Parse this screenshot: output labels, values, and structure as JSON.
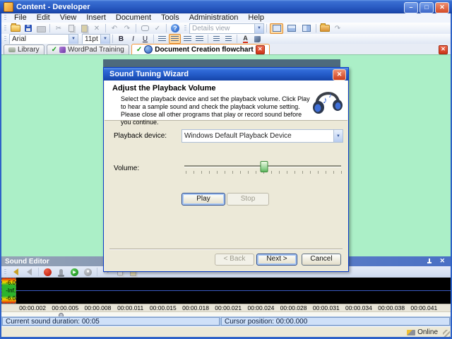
{
  "window": {
    "title": "Content - Developer",
    "status_online": "Online"
  },
  "menu": {
    "items": [
      "File",
      "Edit",
      "View",
      "Insert",
      "Document",
      "Tools",
      "Administration",
      "Help"
    ]
  },
  "toolbars": {
    "details_view": "Details view",
    "font_name": "Arial",
    "font_size": "11pt",
    "bold": "B",
    "italic": "I",
    "underline": "U"
  },
  "tabs": {
    "library": "Library",
    "wordpad": "WordPad Training",
    "flowchart": "Document Creation flowchart"
  },
  "dialog": {
    "title": "Sound Tuning Wizard",
    "heading": "Adjust the Playback Volume",
    "description": "Select the playback device and set the playback volume. Click Play to hear a sample sound and check the playback volume setting. Please close all other programs that play or record sound before you continue.",
    "playback_device_label": "Playback device:",
    "playback_device_value": "Windows Default Playback Device",
    "volume_label": "Volume:",
    "volume_percent": 51,
    "play_label": "Play",
    "stop_label": "Stop",
    "back_label": "< Back",
    "next_label": "Next >",
    "cancel_label": "Cancel"
  },
  "sound_editor": {
    "title": "Sound Editor",
    "meter": {
      "top": "-6.0",
      "mid": "-Inf.",
      "bottom": "-6.0"
    },
    "timeline": [
      "00:00.002",
      "00:00.005",
      "00:00.008",
      "00:00.011",
      "00:00.015",
      "00:00.018",
      "00:00.021",
      "00:00.024",
      "00:00.028",
      "00:00.031",
      "00:00.034",
      "00:00.038",
      "00:00.041"
    ],
    "duration_status": "Current sound duration: 00:05",
    "cursor_status": "Cursor position: 00:00.000"
  },
  "icons": {
    "check": "✓",
    "close": "✕",
    "help": "?",
    "dropdown": "▼",
    "record": "●",
    "play": "▶",
    "stop": "■",
    "cut": "✂",
    "undo": "↶",
    "redo": "↷",
    "note": "♪",
    "minimize": "–",
    "maximize": "□",
    "font_color_letter": "A"
  }
}
